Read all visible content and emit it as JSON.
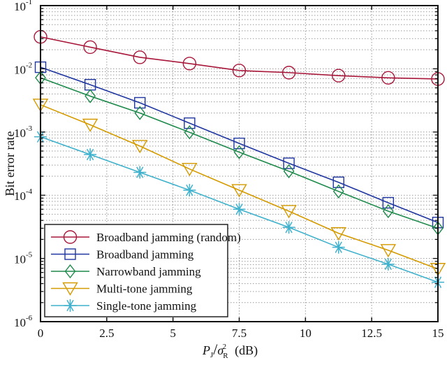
{
  "chart_data": {
    "type": "line",
    "title": "",
    "xlabel": {
      "main": "P",
      "main_sub": "J",
      "slash": "/",
      "sigma": "σ",
      "sigma_sub": "R",
      "sigma_sup": "2",
      "unit": "(dB)"
    },
    "ylabel": "Bit error rate",
    "xlim": [
      0,
      15
    ],
    "ylim": [
      1e-06,
      0.1
    ],
    "yscale": "log",
    "grid": true,
    "legend_position": "bottom-left",
    "x_ticks": [
      0,
      2.5,
      5,
      7.5,
      10,
      12.5,
      15
    ],
    "x_tick_labels": [
      "0",
      "2.5",
      "5",
      "7.5",
      "10",
      "12.5",
      "15"
    ],
    "y_ticks": [
      {
        "base": "10",
        "exp": "-1",
        "value": 0.1
      },
      {
        "base": "10",
        "exp": "-2",
        "value": 0.01
      },
      {
        "base": "10",
        "exp": "-3",
        "value": 0.001
      },
      {
        "base": "10",
        "exp": "-4",
        "value": 0.0001
      },
      {
        "base": "10",
        "exp": "-5",
        "value": 1e-05
      },
      {
        "base": "10",
        "exp": "-6",
        "value": 1e-06
      }
    ],
    "x": [
      0,
      1.875,
      3.75,
      5.625,
      7.5,
      9.375,
      11.25,
      13.125,
      15
    ],
    "series": [
      {
        "name": "Broadband jamming (random)",
        "color": "#a8173a",
        "marker": "circle",
        "values": [
          0.032,
          0.022,
          0.0152,
          0.0121,
          0.0094,
          0.0087,
          0.0078,
          0.0072,
          0.0069
        ]
      },
      {
        "name": "Broadband jamming",
        "color": "#1f35a0",
        "marker": "square",
        "values": [
          0.0106,
          0.0056,
          0.0029,
          0.00138,
          0.00066,
          0.00032,
          0.00016,
          7.6e-05,
          3.7e-05
        ]
      },
      {
        "name": "Narrowband jamming",
        "color": "#1e8a4c",
        "marker": "diamond",
        "values": [
          0.0072,
          0.0037,
          0.002,
          0.00099,
          0.00048,
          0.00024,
          0.000115,
          5.6e-05,
          3e-05
        ]
      },
      {
        "name": "Multi-tone jamming",
        "color": "#d49a00",
        "marker": "triangle-down",
        "values": [
          0.0027,
          0.0013,
          0.0006,
          0.00026,
          0.00012,
          5.6e-05,
          2.5e-05,
          1.35e-05,
          6.8e-06
        ]
      },
      {
        "name": "Single-tone  jamming",
        "color": "#3fb1cc",
        "marker": "asterisk",
        "values": [
          0.00084,
          0.00044,
          0.00023,
          0.00012,
          6e-05,
          3.1e-05,
          1.5e-05,
          8.1e-06,
          4.2e-06
        ]
      }
    ]
  }
}
